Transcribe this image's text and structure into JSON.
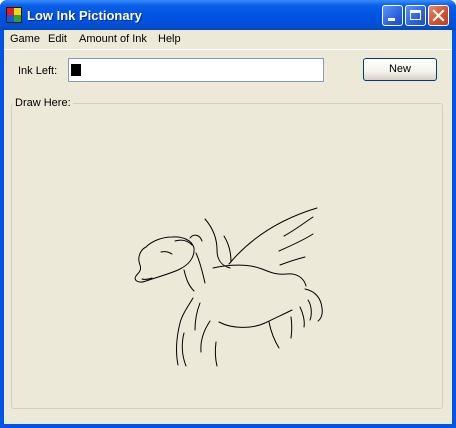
{
  "window": {
    "title": "Low Ink Pictionary"
  },
  "menu": {
    "items": [
      "Game",
      "Edit",
      "Amount of Ink",
      "Help"
    ]
  },
  "ink": {
    "label": "Ink Left:",
    "remaining_fraction": 0.04
  },
  "buttons": {
    "new_label": "New"
  },
  "draw_area": {
    "label": "Draw Here:"
  },
  "colors": {
    "titlebar": "#0054e3",
    "face": "#ece9d8",
    "ink": "#000000"
  }
}
